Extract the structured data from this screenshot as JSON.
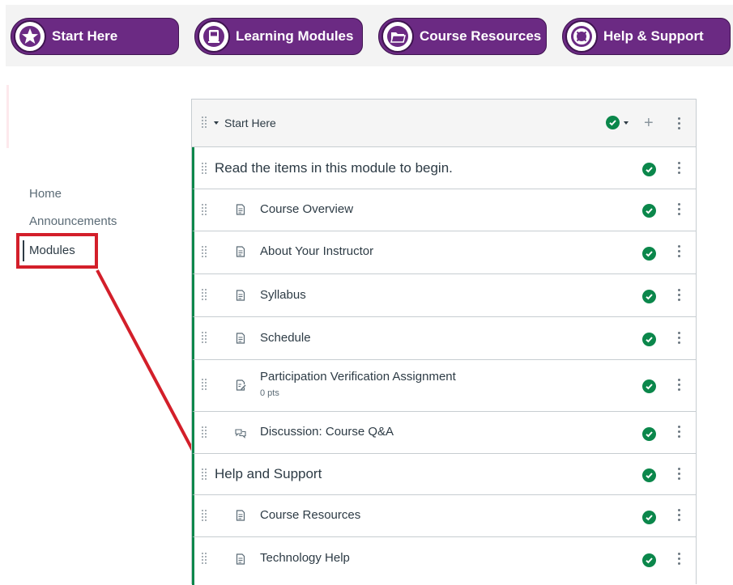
{
  "topnav": {
    "buttons": [
      {
        "label": "Start Here",
        "icon": "star-icon"
      },
      {
        "label": "Learning Modules",
        "icon": "book-icon"
      },
      {
        "label": "Course Resources",
        "icon": "folder-icon"
      },
      {
        "label": "Help & Support",
        "icon": "lifebuoy-icon"
      }
    ],
    "color": "#6b2a83"
  },
  "course_nav": {
    "items": [
      {
        "label": "Home"
      },
      {
        "label": "Announcements"
      },
      {
        "label": "Modules",
        "active": true
      }
    ]
  },
  "module": {
    "title": "Start Here",
    "rows": [
      {
        "type": "subheader",
        "title": "Read the items in this module to begin."
      },
      {
        "type": "page",
        "title": "Course Overview",
        "icon": "page-icon"
      },
      {
        "type": "page",
        "title": "About Your Instructor",
        "icon": "page-icon"
      },
      {
        "type": "page",
        "title": "Syllabus",
        "icon": "page-icon"
      },
      {
        "type": "page",
        "title": "Schedule",
        "icon": "page-icon"
      },
      {
        "type": "assignment",
        "title": "Participation Verification Assignment",
        "points": "0 pts",
        "icon": "assignment-icon"
      },
      {
        "type": "discussion",
        "title": "Discussion: Course Q&A",
        "icon": "discussion-icon"
      },
      {
        "type": "subheader",
        "title": "Help and Support"
      },
      {
        "type": "page",
        "title": "Course Resources",
        "icon": "page-icon"
      },
      {
        "type": "page",
        "title": "Technology Help",
        "icon": "page-icon"
      }
    ],
    "published_color": "#0b874b",
    "annotation_color": "#d31f2a"
  }
}
